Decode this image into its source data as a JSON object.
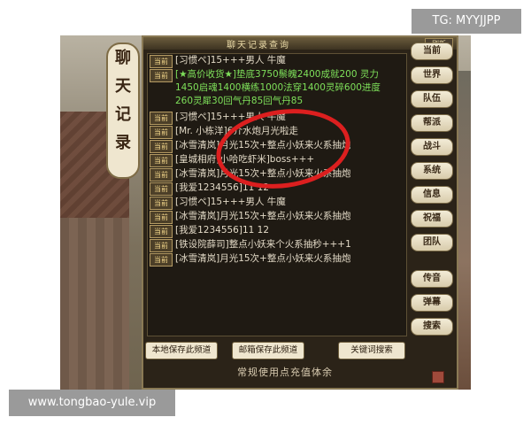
{
  "watermark_top": "TG: MYYJJPP",
  "watermark_bottom": "www.tongbao-yule.vip",
  "window": {
    "title": "聊天记录查询",
    "refresh_label": "刷新",
    "vertical_tab": [
      "聊",
      "天",
      "记",
      "录"
    ]
  },
  "nav": {
    "items": [
      {
        "label": "当前",
        "key": "current"
      },
      {
        "label": "世界",
        "key": "world"
      },
      {
        "label": "队伍",
        "key": "team"
      },
      {
        "label": "帮派",
        "key": "guild"
      },
      {
        "label": "战斗",
        "key": "battle"
      },
      {
        "label": "系统",
        "key": "system"
      },
      {
        "label": "信息",
        "key": "info"
      },
      {
        "label": "祝福",
        "key": "bless"
      },
      {
        "label": "团队",
        "key": "group"
      }
    ],
    "lower_items": [
      {
        "label": "传音",
        "key": "whisper"
      },
      {
        "label": "弹幕",
        "key": "danmaku"
      },
      {
        "label": "搜索",
        "key": "search"
      }
    ]
  },
  "chat": {
    "tag": "当前",
    "messages": [
      {
        "text": "[习惯ペ]15+++男人 牛魔",
        "style": "normal"
      },
      {
        "text": "[★高价收货★]垫底3750鬃魄2400成就200 灵力1450启魂1400横练1000法穿1400灵碎600进度260灵犀30回气丹85回气丹85",
        "style": "green"
      },
      {
        "text": "[习惯ペ]15+++男人 牛魔",
        "style": "normal"
      },
      {
        "text": "[Mr. 小栋洋]6介水炮月光啦走",
        "style": "normal"
      },
      {
        "text": "[冰雪清岚]月光15次+整点小妖来火系抽炮",
        "style": "normal"
      },
      {
        "text": "[皇城相府]小哈吃虾米]boss+++",
        "style": "normal"
      },
      {
        "text": "[冰雪清岚]月光15次+整点小妖来火系抽炮",
        "style": "normal"
      },
      {
        "text": "[我爱1234556]11 12",
        "style": "normal"
      },
      {
        "text": "[习惯ペ]15+++男人 牛魔",
        "style": "normal"
      },
      {
        "text": "[冰雪清岚]月光15次+整点小妖来火系抽炮",
        "style": "normal"
      },
      {
        "text": "[我爱1234556]11 12",
        "style": "normal"
      },
      {
        "text": "[铁设院薛司]整点小妖来个火系抽秒+++1",
        "style": "normal"
      },
      {
        "text": "[冰雪清岚]月光15次+整点小妖来火系抽炮",
        "style": "normal"
      }
    ]
  },
  "bottom": {
    "save_local": "本地保存此频道",
    "save_mail": "邮箱保存此频道",
    "keyword_search": "关键词搜索",
    "footer": "常规使用点充值体余"
  },
  "colors": {
    "annotation": "#dc1f1f",
    "green_text": "#7ee05a",
    "chat_text": "#e2d9c6"
  }
}
